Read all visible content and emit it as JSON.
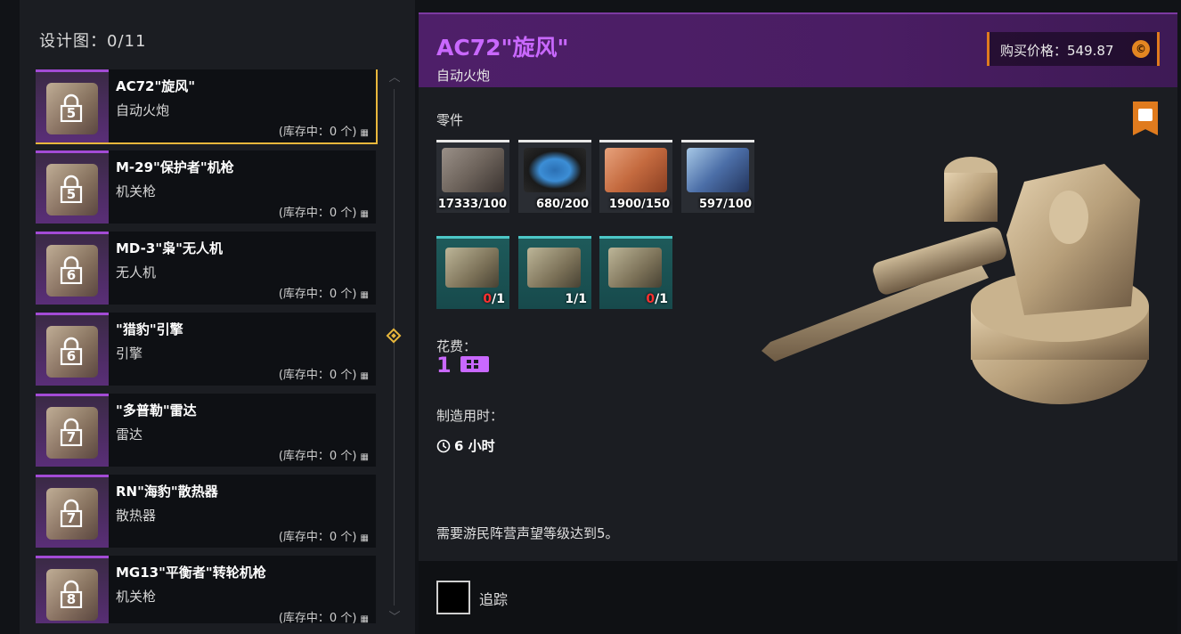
{
  "blueprints": {
    "label": "设计图：",
    "count": "0/11"
  },
  "list": [
    {
      "name": "AC72\"旋风\"",
      "type": "自动火炮",
      "lock_level": "5",
      "stock": "(库存中：0 个)",
      "selected": true
    },
    {
      "name": "M-29\"保护者\"机枪",
      "type": "机关枪",
      "lock_level": "5",
      "stock": "(库存中：0 个)"
    },
    {
      "name": "MD-3\"枭\"无人机",
      "type": "无人机",
      "lock_level": "6",
      "stock": "(库存中：0 个)"
    },
    {
      "name": "\"猎豹\"引擎",
      "type": "引擎",
      "lock_level": "6",
      "stock": "(库存中：0 个)"
    },
    {
      "name": "\"多普勒\"雷达",
      "type": "雷达",
      "lock_level": "7",
      "stock": "(库存中：0 个)"
    },
    {
      "name": "RN\"海豹\"散热器",
      "type": "散热器",
      "lock_level": "7",
      "stock": "(库存中：0 个)"
    },
    {
      "name": "MG13\"平衡者\"转轮机枪",
      "type": "机关枪",
      "lock_level": "8",
      "stock": "(库存中：0 个)"
    }
  ],
  "detail": {
    "title": "AC72\"旋风\"",
    "subtitle": "自动火炮",
    "price_label": "购买价格：549.87",
    "parts_label": "零件",
    "parts": [
      {
        "icon": "scrap-metal-icon",
        "qty": "17333/100"
      },
      {
        "icon": "wires-icon",
        "qty": "680/200"
      },
      {
        "icon": "copper-icon",
        "qty": "1900/150"
      },
      {
        "icon": "electronics-icon",
        "qty": "597/100"
      }
    ],
    "components": [
      {
        "icon": "cannon-component-icon",
        "have": "0",
        "need": "/1"
      },
      {
        "icon": "mechanism-component-icon",
        "have": "1",
        "need": "/1"
      },
      {
        "icon": "autocannon-component-icon",
        "have": "0",
        "need": "/1"
      }
    ],
    "cost_label": "花费：",
    "cost_value": "1",
    "time_label": "制造用时：",
    "time_value": "6 小时",
    "requirement": "需要游民阵营声望等级达到5。",
    "track_label": "追踪"
  },
  "colors": {
    "accent_purple": "#c968ff",
    "selected_gold": "#e8b73c",
    "coin_orange": "#e38621",
    "component_teal": "#4cc7c7"
  }
}
